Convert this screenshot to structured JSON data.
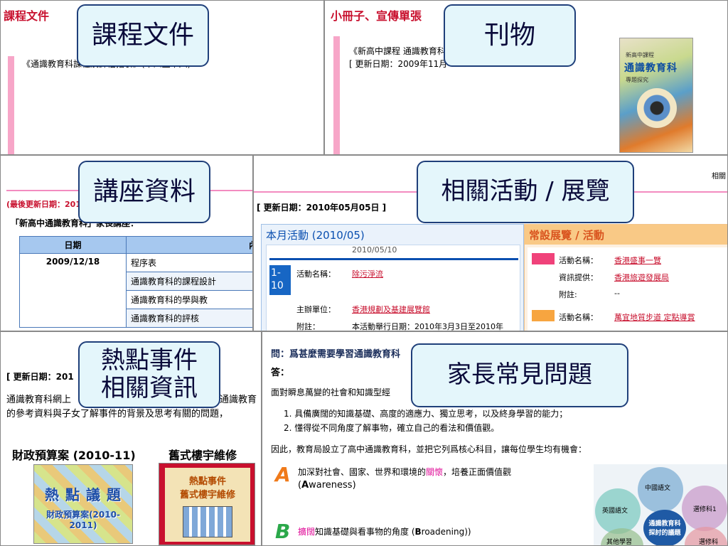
{
  "p1": {
    "title": "課程文件",
    "line": "《通識教育科課程及評估指引》(中四至中六)"
  },
  "p2": {
    "title": "小冊子、宣傳單張",
    "line1": "《新高中課程 通識教育科",
    "line2": "[ 更新日期：2009年11月",
    "book_top": "通識教育科",
    "book_mid": "新高中課程",
    "book_sub": "專題探究"
  },
  "p3": {
    "update": "(最後更新日期：2010",
    "quote": "「新高中通識教育科」家長講座：",
    "col_date": "日期",
    "col_content": "內",
    "date": "2009/12/18",
    "rows": [
      "程序表",
      "通識教育科的課程設計",
      "通識教育科的學與教",
      "通識教育科的評核"
    ]
  },
  "p4": {
    "corner": "相關",
    "update": "[ 更新日期：2010年05月05日 ]",
    "left_title": "本月活動 (2010/05)",
    "left_date": "2010/05/10",
    "badge": "1-\n10",
    "act_label": "活動名稱：",
    "act_value": "除污淨流",
    "org_label": "主辦單位：",
    "org_value": "香港規劃及基建展覽館",
    "note_label": "附註：",
    "note_value": "本活動舉行日期：2010年3月3日至2010年",
    "right_title": "常設展覽 / 活動",
    "r1_label": "活動名稱：",
    "r1_value": "香港盛事一覽",
    "r2_label": "資訊提供：",
    "r2_value": "香港旅遊發展局",
    "r3_label": "附註:",
    "r3_value": "--",
    "r4_label": "活動名稱：",
    "r4_value": "萬宜地質步道 定點導賞"
  },
  "p5": {
    "update": "[ 更新日期：201",
    "text1": "通識教育科網上",
    "text1b": "通識教育",
    "text2": "的參考資料與子女了解事件的背景及思考有關的問題，",
    "h1": "財政預算案 (2010-11)",
    "h2": "舊式樓宇維修",
    "img1_top": "熱 點 議 題",
    "img1_bot": "財政預算案(2010-2011)",
    "img2_top": "熱點事件",
    "img2_bot": "舊式樓宇維修"
  },
  "p6": {
    "q": "問：爲甚麼需要學習通識教育科",
    "a": "答：",
    "intro": "面對瞬息萬變的社會和知識型經",
    "li1": "具備廣闊的知識基礎、高度的適應力、獨立思考，以及終身學習的能力；",
    "li2": "懂得從不同角度了解事物，確立自己的看法和價值觀。",
    "therefore": "因此，教育局設立了高中通識教育科，並把它列爲核心科目，讓每位學生均有機會：",
    "A_letter": "A",
    "A_pre": "加深對社會、國家、世界和環境的",
    "A_hl": "關懷",
    "A_post": "，培養正面價值觀",
    "A_sub1": "(",
    "A_sub2": "A",
    "A_sub3": "wareness)",
    "B_letter": "B",
    "B_hl": "擴闊",
    "B_post": "知識基礎與看事物的角度 (",
    "B_sub2": "B",
    "B_sub3": "roadening)",
    "d_center": "通識教育科\n探討的議題",
    "d_top": "中國語文",
    "d_left": "英國語文",
    "d_right": "選修科1",
    "d_bl": "其他學習",
    "d_br": "選修科"
  },
  "callouts": {
    "c1": "課程文件",
    "c2": "刊物",
    "c3": "講座資料",
    "c4": "相關活動 / 展覽",
    "c5a": "熱點事件",
    "c5b": "相關資訊",
    "c6": "家長常見問題"
  },
  "colors": {
    "accent_red": "#c8102e",
    "callout_bg": "#e4f6fb",
    "callout_border": "#1f3f7a",
    "blue_header": "#0a4fb0",
    "orange_header": "#f7a540"
  }
}
